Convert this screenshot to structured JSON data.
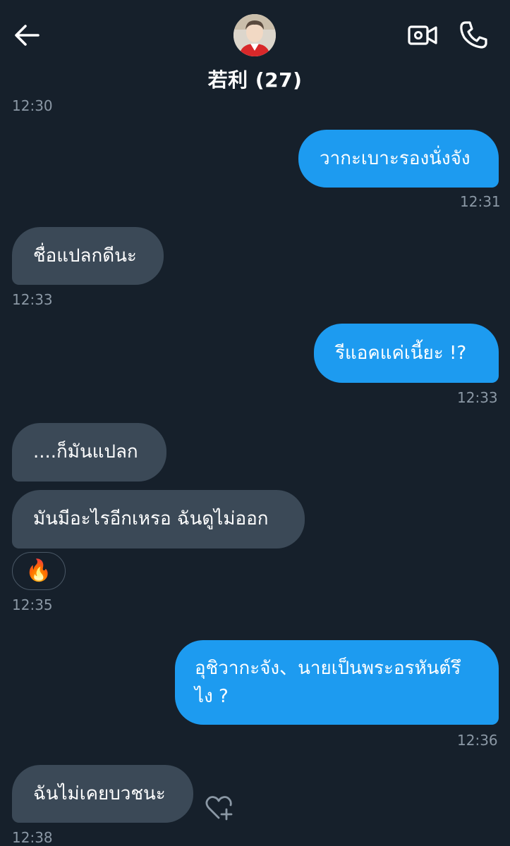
{
  "header": {
    "title": "若利 (27)",
    "icons": [
      "back-arrow-icon",
      "avatar",
      "video-call-icon",
      "phone-icon"
    ]
  },
  "messages": [
    {
      "time": "12:30"
    },
    {
      "direction": "outgoing",
      "text": "วากะเบาะรองนั่งจัง",
      "time": "12:31"
    },
    {
      "direction": "incoming",
      "text": "ชื่อแปลกดีนะ",
      "time": "12:33"
    },
    {
      "direction": "outgoing",
      "text": "รีแอคแค่เนี้ยะ !?",
      "time": "12:33"
    },
    {
      "direction": "incoming",
      "text": "....ก็มันแปลก"
    },
    {
      "direction": "incoming",
      "text": "มันมีอะไรอีกเหรอ ฉันดูไม่ออก",
      "reaction": "🔥",
      "time": "12:35"
    },
    {
      "direction": "outgoing",
      "lines": [
        "อุชิวากะจัง、นายเป็นพระอรหันต์รึ",
        "ไง ?"
      ],
      "time": "12:36"
    },
    {
      "direction": "incoming",
      "text": "ฉันไม่เคยบวชนะ",
      "time": "12:38"
    }
  ],
  "colors": {
    "background": "#16202b",
    "incoming_bubble": "#3b4957",
    "outgoing_bubble": "#1d9bf0",
    "timestamp": "#8b98a5"
  }
}
